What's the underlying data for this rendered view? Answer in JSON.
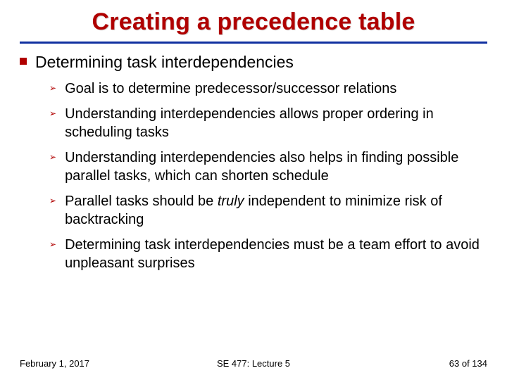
{
  "title": "Creating a precedence table",
  "main_point": "Determining task interdependencies",
  "bullets": [
    "Goal is to determine predecessor/successor relations",
    "Understanding interdependencies allows proper ordering in scheduling tasks",
    "Understanding interdependencies also helps in finding possible parallel tasks, which can shorten schedule",
    "Parallel tasks should be <em>truly</em> independent to minimize risk of backtracking",
    "Determining task interdependencies must be a team effort to avoid unpleasant surprises"
  ],
  "footer": {
    "date": "February 1, 2017",
    "center": "SE 477: Lecture 5",
    "page": "63 of 134"
  }
}
